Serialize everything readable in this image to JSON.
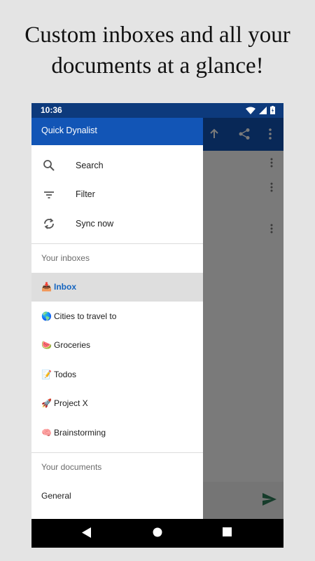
{
  "headline": {
    "line1": "Custom inboxes and all your",
    "line2": "documents at a glance!"
  },
  "status_bar": {
    "time": "10:36"
  },
  "drawer": {
    "title": "Quick Dynalist",
    "menu": [
      {
        "icon": "search-icon",
        "label": "Search"
      },
      {
        "icon": "filter-icon",
        "label": "Filter"
      },
      {
        "icon": "sync-icon",
        "label": "Sync now"
      }
    ],
    "inboxes_title": "Your inboxes",
    "inboxes": [
      {
        "emoji": "📥",
        "label": "Inbox",
        "selected": true
      },
      {
        "emoji": "🌎",
        "label": "Cities to travel to"
      },
      {
        "emoji": "🍉",
        "label": "Groceries"
      },
      {
        "emoji": "📝",
        "label": "Todos"
      },
      {
        "emoji": "🚀",
        "label": "Project X"
      },
      {
        "emoji": "🧠",
        "label": "Brainstorming"
      }
    ],
    "documents_title": "Your documents",
    "documents": [
      {
        "label": "General"
      }
    ]
  },
  "colors": {
    "primary": "#1255b6",
    "status_bar": "#0d3a7c",
    "selected_text": "#1565c0",
    "selected_bg": "#dedede",
    "send_icon": "#2e7d5b"
  },
  "icons": {
    "appbar": [
      "arrow-up-icon",
      "share-icon",
      "more-vert-icon"
    ],
    "nav": [
      "back-icon",
      "home-icon",
      "recents-icon"
    ],
    "bottom": "send-icon"
  }
}
